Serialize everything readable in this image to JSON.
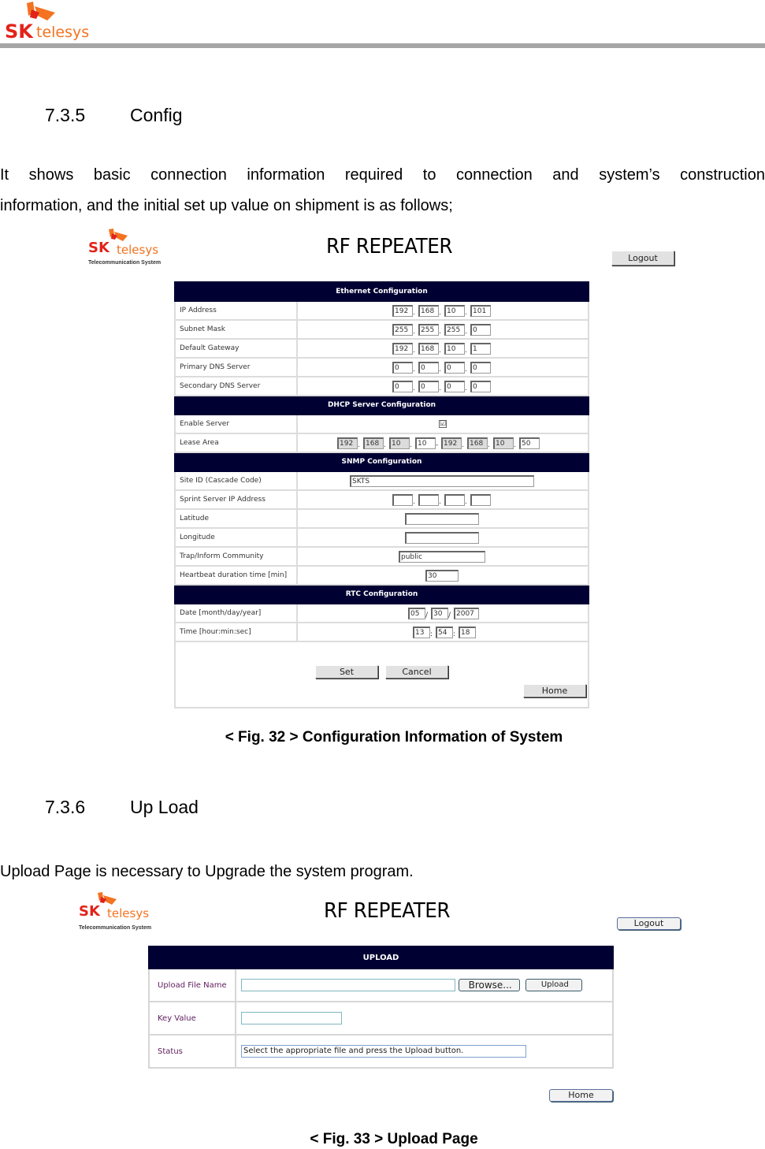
{
  "page_header": {
    "logo_sk": "SK",
    "logo_telesys": "telesys"
  },
  "section_735": {
    "number": "7.3.5",
    "title": "Config",
    "paragraph_line1": "It  shows  basic  connection  information  required  to  connection  and  system’s  construction",
    "paragraph_line2": "information, and the initial set up value on shipment is as follows;"
  },
  "fig32": {
    "logo_sk": "SK",
    "logo_telesys": "telesys",
    "logo_sub": "Telecommunication System",
    "title": "RF  REPEATER",
    "logout_label": "Logout",
    "sections": {
      "ethernet": "Ethernet Configuration",
      "dhcp": "DHCP Server Configuration",
      "snmp": "SNMP Configuration",
      "rtc": "RTC Configuration"
    },
    "ethernet": {
      "ip_label": "IP Address",
      "ip": [
        "192",
        "168",
        "10",
        "101"
      ],
      "mask_label": "Subnet Mask",
      "mask": [
        "255",
        "255",
        "255",
        "0"
      ],
      "gw_label": "Default Gateway",
      "gw": [
        "192",
        "168",
        "10",
        "1"
      ],
      "dns1_label": "Primary DNS Server",
      "dns1": [
        "0",
        "0",
        "0",
        "0"
      ],
      "dns2_label": "Secondary DNS Server",
      "dns2": [
        "0",
        "0",
        "0",
        "0"
      ]
    },
    "dhcp": {
      "enable_label": "Enable Server",
      "enable_checked": "☑",
      "lease_label": "Lease Area",
      "lease": [
        "192",
        "168",
        "10",
        "10",
        "192",
        "168",
        "10",
        "50"
      ]
    },
    "snmp": {
      "site_label": "Site ID (Cascade Code)",
      "site": "SKTS",
      "sprint_label": "Sprint Server IP Address",
      "sprint": [
        "",
        "",
        "",
        ""
      ],
      "lat_label": "Latitude",
      "lat": "",
      "lon_label": "Longitude",
      "lon": "",
      "trap_label": "Trap/Inform Community",
      "trap": "public",
      "hb_label": "Heartbeat duration time [min]",
      "hb": "30"
    },
    "rtc": {
      "date_label": "Date [month/day/year]",
      "date": [
        "05",
        "30",
        "2007"
      ],
      "time_label": "Time [hour:min:sec]",
      "time": [
        "13",
        "54",
        "18"
      ]
    },
    "set_label": "Set",
    "cancel_label": "Cancel",
    "home_label": "Home",
    "caption": "< Fig. 32 > Configuration Information of System"
  },
  "section_736": {
    "number": "7.3.6",
    "title": "Up Load",
    "paragraph": "Upload Page is necessary to Upgrade the system program."
  },
  "fig33": {
    "logo_sk": "SK",
    "logo_telesys": "telesys",
    "logo_sub": "Telecommunication System",
    "title": "RF  REPEATER",
    "logout_label": "Logout",
    "section": "UPLOAD",
    "file_label": "Upload File Name",
    "file_value": "",
    "browse_label": "Browse...",
    "upload_label": "Upload",
    "key_label": "Key Value",
    "key_value": "",
    "status_label": "Status",
    "status_value": "Select the appropriate file and press the Upload button.",
    "home_label": "Home",
    "caption": "< Fig. 33 > Upload Page"
  }
}
